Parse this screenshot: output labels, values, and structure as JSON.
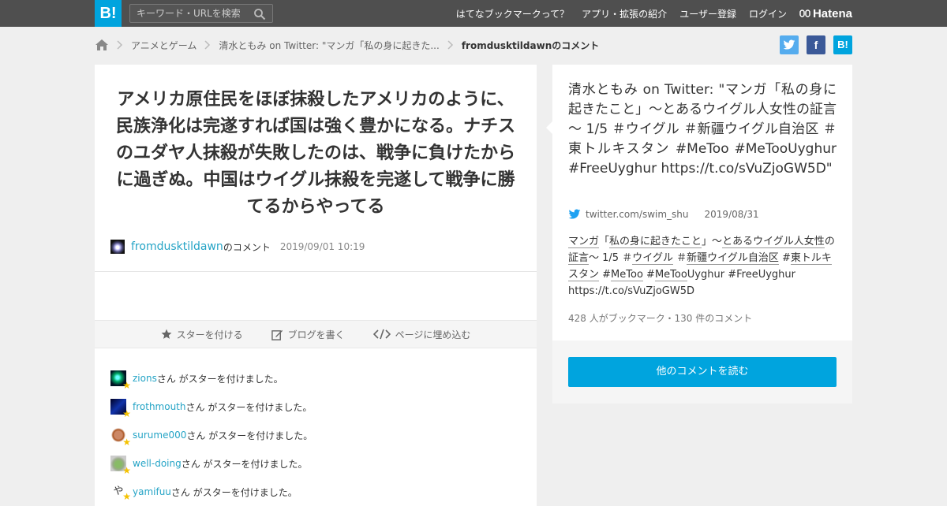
{
  "header": {
    "logo": "B!",
    "search_placeholder": "キーワード・URLを検索",
    "nav": [
      "はてなブックマークって？",
      "アプリ・拡張の紹介",
      "ユーザー登録",
      "ログイン"
    ],
    "brand": "Hatena"
  },
  "breadcrumb": {
    "items": [
      "アニメとゲーム",
      "清水ともみ on Twitter: \"マンガ「私の身に起きた...",
      "fromdusktildawnのコメント"
    ]
  },
  "share": {
    "twitter": "t",
    "facebook": "f",
    "hatena": "B!"
  },
  "comment": {
    "text": "アメリカ原住民をほぼ抹殺したアメリカのように、民族浄化は完遂すれば国は強く豊かになる。ナチスのユダヤ人抹殺が失敗したのは、戦争に負けたからに過ぎぬ。中国はウイグル抹殺を完遂して戦争に勝てるからやってる",
    "user": "fromdusktildawn",
    "suffix": "のコメント",
    "date": "2019/09/01 10:19"
  },
  "actions": {
    "star": "スターを付ける",
    "blog": "ブログを書く",
    "embed": "ページに埋め込む"
  },
  "stars": [
    {
      "name": "zions",
      "suffix": "さん がスターを付けました。"
    },
    {
      "name": "frothmouth",
      "suffix": "さん がスターを付けました。"
    },
    {
      "name": "surume000",
      "suffix": "さん がスターを付けました。"
    },
    {
      "name": "well-doing",
      "suffix": "さん がスターを付けました。"
    },
    {
      "name": "yamifuu",
      "suffix": "さん がスターを付けました。"
    }
  ],
  "entry": {
    "title": "清水ともみ on Twitter: \"マンガ「私の身に起きたこと」～とあるウイグル人女性の証言～ 1/5 ＃ウイグル ＃新疆ウイグル自治区 ＃東トルキスタン #MeToo #MeTooUyghur #FreeUyghur https://t.co/sVuZjoGW5D\"",
    "source": "twitter.com/swim_shu",
    "date": "2019/08/31",
    "desc": {
      "p1": "マンガ",
      "p2": "「",
      "p3": "私の身に起きたこと",
      "p4": "」～",
      "p5": "とあるウイグル人女性",
      "p6": "の",
      "p7": "証言",
      "p8": "～ 1/5 ＃",
      "p9": "ウイグル",
      "p10": " ＃",
      "p11": "新疆ウイグル自治区",
      "p12": " #",
      "p13": "東トルキスタン",
      "p14": " #",
      "p15": "MeToo",
      "p16": " #",
      "p17": "MeToo",
      "p18": "Uyghur #FreeUyghur https://t.co/sVuZjoGW5D"
    },
    "count": "428 人がブックマーク・130 件のコメント",
    "read_button": "他のコメントを読む"
  }
}
